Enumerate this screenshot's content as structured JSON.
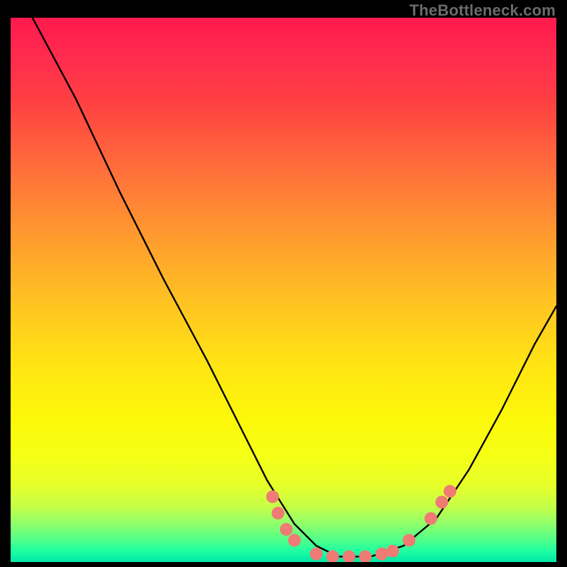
{
  "attribution": "TheBottleneck.com",
  "chart_data": {
    "type": "line",
    "title": "",
    "xlabel": "",
    "ylabel": "",
    "xlim": [
      0,
      100
    ],
    "ylim": [
      0,
      100
    ],
    "curve": {
      "name": "bottleneck-curve",
      "color": "#000000",
      "points": [
        {
          "x": 4,
          "y": 100
        },
        {
          "x": 12,
          "y": 85
        },
        {
          "x": 20,
          "y": 68
        },
        {
          "x": 28,
          "y": 52
        },
        {
          "x": 36,
          "y": 37
        },
        {
          "x": 42,
          "y": 25
        },
        {
          "x": 47,
          "y": 15
        },
        {
          "x": 52,
          "y": 7
        },
        {
          "x": 56,
          "y": 3
        },
        {
          "x": 60,
          "y": 1
        },
        {
          "x": 66,
          "y": 1
        },
        {
          "x": 72,
          "y": 3
        },
        {
          "x": 78,
          "y": 8
        },
        {
          "x": 84,
          "y": 17
        },
        {
          "x": 90,
          "y": 28
        },
        {
          "x": 96,
          "y": 40
        },
        {
          "x": 100,
          "y": 47
        }
      ]
    },
    "markers": {
      "name": "data-markers",
      "color": "#ef7b74",
      "radius": 9,
      "points": [
        {
          "x": 48,
          "y": 12
        },
        {
          "x": 49,
          "y": 9
        },
        {
          "x": 50.5,
          "y": 6
        },
        {
          "x": 52,
          "y": 4
        },
        {
          "x": 56,
          "y": 1.5
        },
        {
          "x": 59,
          "y": 1
        },
        {
          "x": 62,
          "y": 1
        },
        {
          "x": 65,
          "y": 1
        },
        {
          "x": 68,
          "y": 1.5
        },
        {
          "x": 70,
          "y": 2
        },
        {
          "x": 73,
          "y": 4
        },
        {
          "x": 77,
          "y": 8
        },
        {
          "x": 79,
          "y": 11
        },
        {
          "x": 80.5,
          "y": 13
        }
      ]
    }
  }
}
